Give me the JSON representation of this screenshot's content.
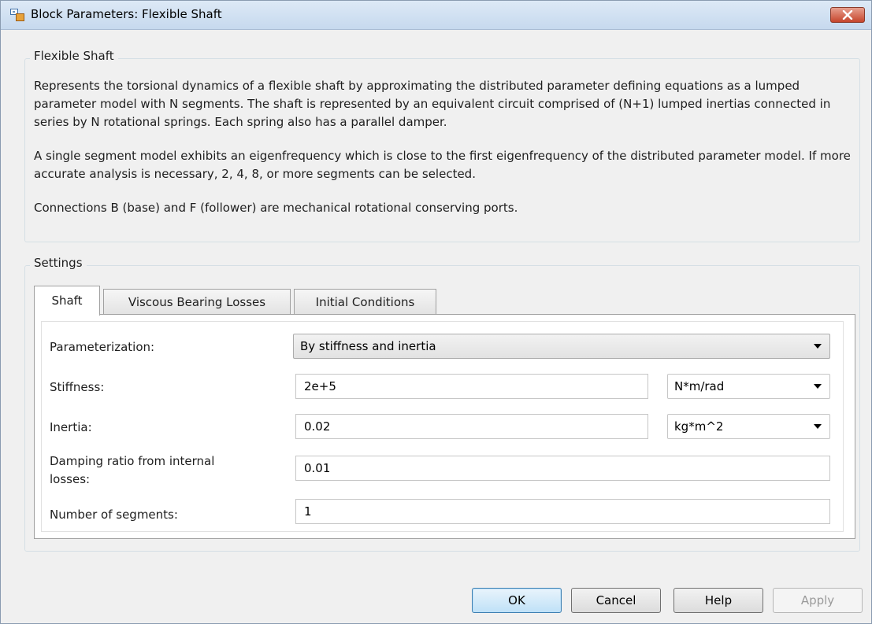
{
  "window": {
    "title": "Block Parameters: Flexible Shaft"
  },
  "description_group": {
    "legend": "Flexible Shaft",
    "paragraphs": [
      "Represents the torsional dynamics of a flexible shaft by approximating the distributed parameter defining equations as a lumped parameter model with N segments. The shaft is represented by an equivalent circuit comprised of (N+1) lumped inertias connected in series by N rotational springs. Each spring also has a parallel damper.",
      "A single segment model exhibits an eigenfrequency which is close to the first eigenfrequency of the distributed parameter model. If more accurate analysis is necessary, 2, 4, 8, or more segments can be selected.",
      "Connections B (base) and F (follower) are mechanical rotational conserving ports."
    ]
  },
  "settings_group": {
    "legend": "Settings",
    "tabs": [
      {
        "label": "Shaft",
        "active": true
      },
      {
        "label": "Viscous Bearing Losses",
        "active": false
      },
      {
        "label": "Initial Conditions",
        "active": false
      }
    ],
    "fields": {
      "parameterization": {
        "label": "Parameterization:",
        "value": "By stiffness and inertia"
      },
      "stiffness": {
        "label": "Stiffness:",
        "value": "2e+5",
        "unit": "N*m/rad"
      },
      "inertia": {
        "label": "Inertia:",
        "value": "0.02",
        "unit": "kg*m^2"
      },
      "damping": {
        "label_line1": "Damping ratio from internal",
        "label_line2": "losses:",
        "value": "0.01"
      },
      "segments": {
        "label": "Number of segments:",
        "value": "1"
      }
    }
  },
  "buttons": {
    "ok": "OK",
    "cancel": "Cancel",
    "help": "Help",
    "apply": "Apply"
  },
  "colors": {
    "window_bg": "#f0f0f0",
    "title_bar": "#c6d9ee",
    "close_button": "#c6452c",
    "default_button": "#bfe1f7"
  }
}
